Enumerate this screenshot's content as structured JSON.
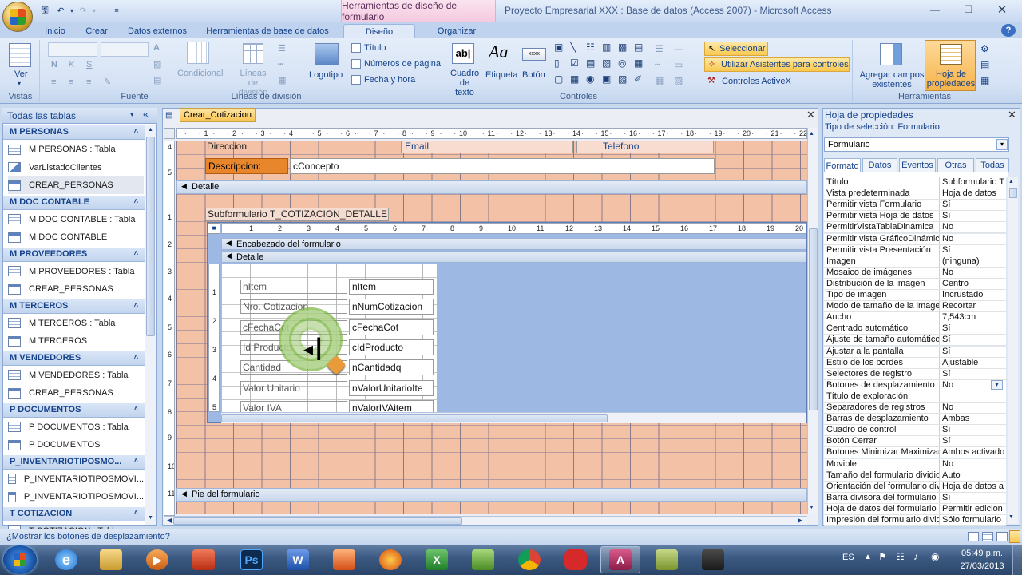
{
  "title_bar": {
    "context_tab_group": "Herramientas de diseño de formulario",
    "window_title": "Proyecto Empresarial XXX : Base de datos (Access 2007)  -  Microsoft Access"
  },
  "tabs": [
    "Inicio",
    "Crear",
    "Datos externos",
    "Herramientas de base de datos",
    "Diseño",
    "Organizar"
  ],
  "ribbon": {
    "vistas": {
      "button": "Ver",
      "label": "Vistas"
    },
    "fuente": {
      "label": "Fuente",
      "bold": "N",
      "italic": "K",
      "underline": "S",
      "condicional": "Condicional"
    },
    "lineas": {
      "button": "Líneas de división",
      "label": "Líneas de división"
    },
    "controles": {
      "logotipo": "Logotipo",
      "titulo": "Título",
      "numeros": "Números de página",
      "fecha": "Fecha y hora",
      "cuadro": "Cuadro de texto",
      "etiqueta": "Etiqueta",
      "boton": "Botón",
      "label": "Controles",
      "seleccionar": "Seleccionar",
      "asistentes": "Utilizar Asistentes para controles",
      "activex": "Controles ActiveX",
      "sample_ab": "ab|",
      "sample_aa": "Aa",
      "sample_xxx": "xxxx"
    },
    "herramientas": {
      "agregar": "Agregar campos existentes",
      "hoja": "Hoja de propiedades",
      "label": "Herramientas"
    }
  },
  "nav": {
    "header": "Todas las tablas",
    "groups": [
      {
        "name": "M PERSONAS",
        "items": [
          {
            "label": "M PERSONAS : Tabla",
            "type": "table"
          },
          {
            "label": "VarListadoClientes",
            "type": "query"
          },
          {
            "label": "CREAR_PERSONAS",
            "type": "form",
            "selected": true
          }
        ]
      },
      {
        "name": "M DOC CONTABLE",
        "items": [
          {
            "label": "M DOC CONTABLE : Tabla",
            "type": "table"
          },
          {
            "label": "M DOC CONTABLE",
            "type": "form"
          }
        ]
      },
      {
        "name": "M PROVEEDORES",
        "items": [
          {
            "label": "M PROVEEDORES : Tabla",
            "type": "table"
          },
          {
            "label": "CREAR_PERSONAS",
            "type": "form"
          }
        ]
      },
      {
        "name": "M TERCEROS",
        "items": [
          {
            "label": "M TERCEROS : Tabla",
            "type": "table"
          },
          {
            "label": "M TERCEROS",
            "type": "form"
          }
        ]
      },
      {
        "name": "M VENDEDORES",
        "items": [
          {
            "label": "M VENDEDORES : Tabla",
            "type": "table"
          },
          {
            "label": "CREAR_PERSONAS",
            "type": "form"
          }
        ]
      },
      {
        "name": "P DOCUMENTOS",
        "items": [
          {
            "label": "P DOCUMENTOS : Tabla",
            "type": "table"
          },
          {
            "label": "P DOCUMENTOS",
            "type": "form"
          }
        ]
      },
      {
        "name": "P_INVENTARIOTIPOSMO...",
        "items": [
          {
            "label": "P_INVENTARIOTIPOSMOVI...",
            "type": "table"
          },
          {
            "label": "P_INVENTARIOTIPOSMOVI...",
            "type": "form"
          }
        ]
      },
      {
        "name": "T COTIZACION",
        "items": [
          {
            "label": "T COTIZACION : Tabla",
            "type": "table"
          }
        ]
      }
    ]
  },
  "doc": {
    "tab": "Crear_Cotizacion",
    "ruler_nums": [
      "1",
      "2",
      "3",
      "4",
      "5",
      "6",
      "7",
      "8",
      "9",
      "10",
      "11",
      "12",
      "13",
      "14",
      "15",
      "16",
      "17",
      "18",
      "19",
      "20",
      "21",
      "22"
    ],
    "header_labels": {
      "direccion": "Direccion",
      "email": "Email",
      "telefono": "Telefono",
      "descripcion": "Descripcion:",
      "concepto": "cConcepto"
    },
    "sections": {
      "detalle": "Detalle",
      "pie": "Pie del formulario"
    },
    "subform_label": "Subformulario T_COTIZACION_DETALLE",
    "sub_sections": {
      "encabezado": "Encabezado del formulario",
      "detalle": "Detalle"
    },
    "fields": [
      {
        "label": "nItem",
        "control": "nItem"
      },
      {
        "label": "Nro. Cotizacion",
        "control": "nNumCotizacion"
      },
      {
        "label": "cFechaCot",
        "control": "cFechaCot"
      },
      {
        "label": "Id Producto",
        "control": "cIdProducto"
      },
      {
        "label": "Cantidad",
        "control": "nCantidadq"
      },
      {
        "label": "Valor Unitario",
        "control": "nValorUnitarioIte"
      },
      {
        "label": "Valor IVA",
        "control": "nValorIVAitem"
      }
    ],
    "vruler": [
      "4",
      "5",
      "1",
      "2",
      "3",
      "4",
      "5",
      "6",
      "7",
      "8",
      "9",
      "10",
      "11"
    ],
    "vruler_sub": [
      "1",
      "2",
      "3",
      "4",
      "5"
    ]
  },
  "props": {
    "title": "Hoja de propiedades",
    "sel_label": "Tipo de selección:",
    "sel_type": "Formulario",
    "object": "Formulario",
    "tabs": [
      "Formato",
      "Datos",
      "Eventos",
      "Otras",
      "Todas"
    ],
    "rows": [
      [
        "Título",
        "Subformulario T"
      ],
      [
        "Vista predeterminada",
        "Hoja de datos"
      ],
      [
        "Permitir vista Formulario",
        "Sí"
      ],
      [
        "Permitir vista Hoja de datos",
        "Sí"
      ],
      [
        "PermitirVistaTablaDinámica",
        "No"
      ],
      [
        "Permitir vista GráficoDinámico",
        "No"
      ],
      [
        "Permitir vista Presentación",
        "Sí"
      ],
      [
        "Imagen",
        "(ninguna)"
      ],
      [
        "Mosaico de imágenes",
        "No"
      ],
      [
        "Distribución de la imagen",
        "Centro"
      ],
      [
        "Tipo de imagen",
        "Incrustado"
      ],
      [
        "Modo de tamaño de la imagen",
        "Recortar"
      ],
      [
        "Ancho",
        "7,543cm"
      ],
      [
        "Centrado automático",
        "Sí"
      ],
      [
        "Ajuste de tamaño automático",
        "Sí"
      ],
      [
        "Ajustar a la pantalla",
        "Sí"
      ],
      [
        "Estilo de los bordes",
        "Ajustable"
      ],
      [
        "Selectores de registro",
        "Sí"
      ],
      [
        "Botones de desplazamiento",
        "No"
      ],
      [
        "Título de exploración",
        ""
      ],
      [
        "Separadores de registros",
        "No"
      ],
      [
        "Barras de desplazamiento",
        "Ambas"
      ],
      [
        "Cuadro de control",
        "Sí"
      ],
      [
        "Botón Cerrar",
        "Sí"
      ],
      [
        "Botones Minimizar Maximizar",
        "Ambos activado"
      ],
      [
        "Movible",
        "No"
      ],
      [
        "Tamaño del formulario dividido",
        "Auto"
      ],
      [
        "Orientación del formulario dividido",
        "Hoja de datos a"
      ],
      [
        "Barra divisora del formulario",
        "Sí"
      ],
      [
        "Hoja de datos del formulario",
        "Permitir edicion"
      ],
      [
        "Impresión del formulario dividido",
        "Sólo formulario"
      ]
    ]
  },
  "status": {
    "text": "¿Mostrar los botones de desplazamiento?"
  },
  "taskbar": {
    "lang": "ES",
    "time": "05:49 p.m.",
    "date": "27/03/2013"
  },
  "colors": {
    "grid": "#f3c2a6",
    "subform_bg": "#9db8e2",
    "accent": "#f9c451"
  }
}
